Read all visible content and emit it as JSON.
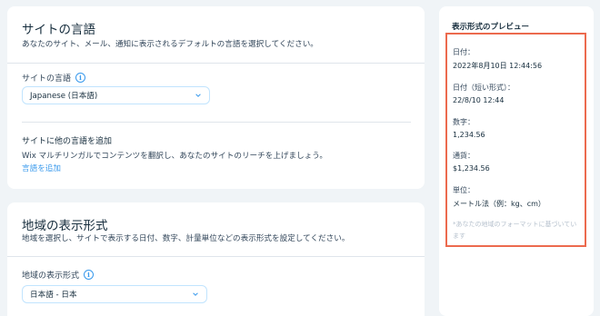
{
  "site_language": {
    "title": "サイトの言語",
    "subtitle": "あなたのサイト、メール、通知に表示されるデフォルトの言語を選択してください。",
    "field_label": "サイトの言語",
    "selected": "Japanese (日本語)",
    "add_section_title": "サイトに他の言語を追加",
    "add_section_desc": "Wix マルチリンガルでコンテンツを翻訳し、あなたのサイトのリーチを上げましょう。",
    "add_link": "言語を追加"
  },
  "regional": {
    "title": "地域の表示形式",
    "subtitle": "地域を選択し、サイトで表示する日付、数字、計量単位などの表示形式を設定してください。",
    "field_label": "地域の表示形式",
    "selected": "日本語 - 日本"
  },
  "preview": {
    "title": "表示形式のプレビュー",
    "items": [
      {
        "label": "日付：",
        "value": "2022年8月10日 12:44:56"
      },
      {
        "label": "日付（短い形式）：",
        "value": "22/8/10 12:44"
      },
      {
        "label": "数字：",
        "value": "1,234.56"
      },
      {
        "label": "通貨：",
        "value": "$1,234.56"
      },
      {
        "label": "単位：",
        "value": "メートル法（例：kg、cm）"
      }
    ],
    "note": "*あなたの地域のフォーマットに基づいています"
  },
  "colors": {
    "accent": "#3899ec",
    "highlight_border": "#ec6a4e",
    "background": "#f0f4f7"
  },
  "icons": [
    "info-icon",
    "chevron-down-icon"
  ]
}
